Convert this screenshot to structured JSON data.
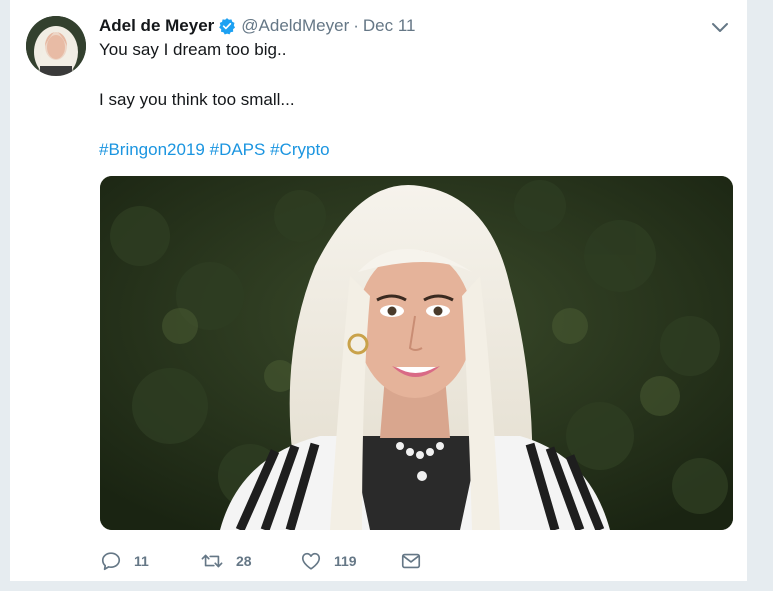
{
  "tweet": {
    "author_name": "Adel de Meyer",
    "handle": "@AdeldMeyer",
    "separator": "·",
    "date": "Dec 11",
    "verified": true,
    "text_line1": "You say I dream too big..",
    "text_line2": "I say you think too small...",
    "hashtags": [
      "#Bringon2019",
      "#DAPS",
      "#Crypto"
    ]
  },
  "actions": {
    "reply_count": "11",
    "retweet_count": "28",
    "like_count": "119"
  },
  "icons": {
    "verified": "verified-badge-icon",
    "caret": "chevron-down-icon",
    "reply": "reply-icon",
    "retweet": "retweet-icon",
    "like": "heart-icon",
    "dm": "envelope-icon"
  },
  "colors": {
    "link": "#1b95e0",
    "verified": "#1da1f2",
    "muted": "#657786",
    "text": "#14171a"
  }
}
